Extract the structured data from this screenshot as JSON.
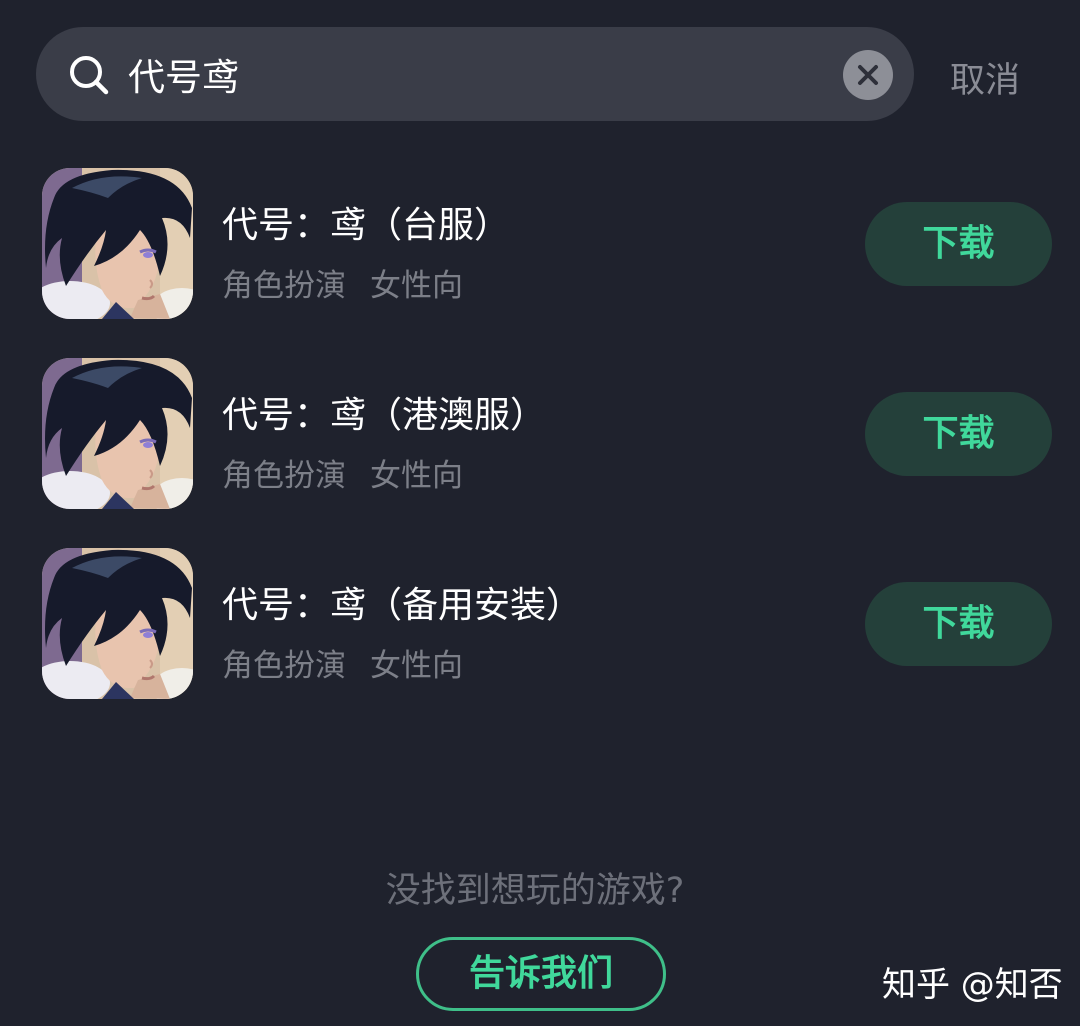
{
  "search": {
    "query": "代号鸢",
    "cancel_label": "取消"
  },
  "results": [
    {
      "title": "代号：鸢（台服）",
      "tags": [
        "角色扮演",
        "女性向"
      ],
      "action_label": "下载"
    },
    {
      "title": "代号：鸢（港澳服）",
      "tags": [
        "角色扮演",
        "女性向"
      ],
      "action_label": "下载"
    },
    {
      "title": "代号：鸢（备用安装）",
      "tags": [
        "角色扮演",
        "女性向"
      ],
      "action_label": "下载"
    }
  ],
  "footer": {
    "hint": "没找到想玩的游戏?",
    "feedback_label": "告诉我们"
  },
  "watermark": "知乎 @知否",
  "colors": {
    "background": "#1f222d",
    "search_bar": "#3a3d48",
    "accent_green": "#40d89b",
    "button_bg": "#24403a",
    "muted_text": "#7c7f88"
  },
  "icons": {
    "search": "search-icon",
    "clear": "clear-icon",
    "app_icon": "app-icon-character-portrait"
  }
}
